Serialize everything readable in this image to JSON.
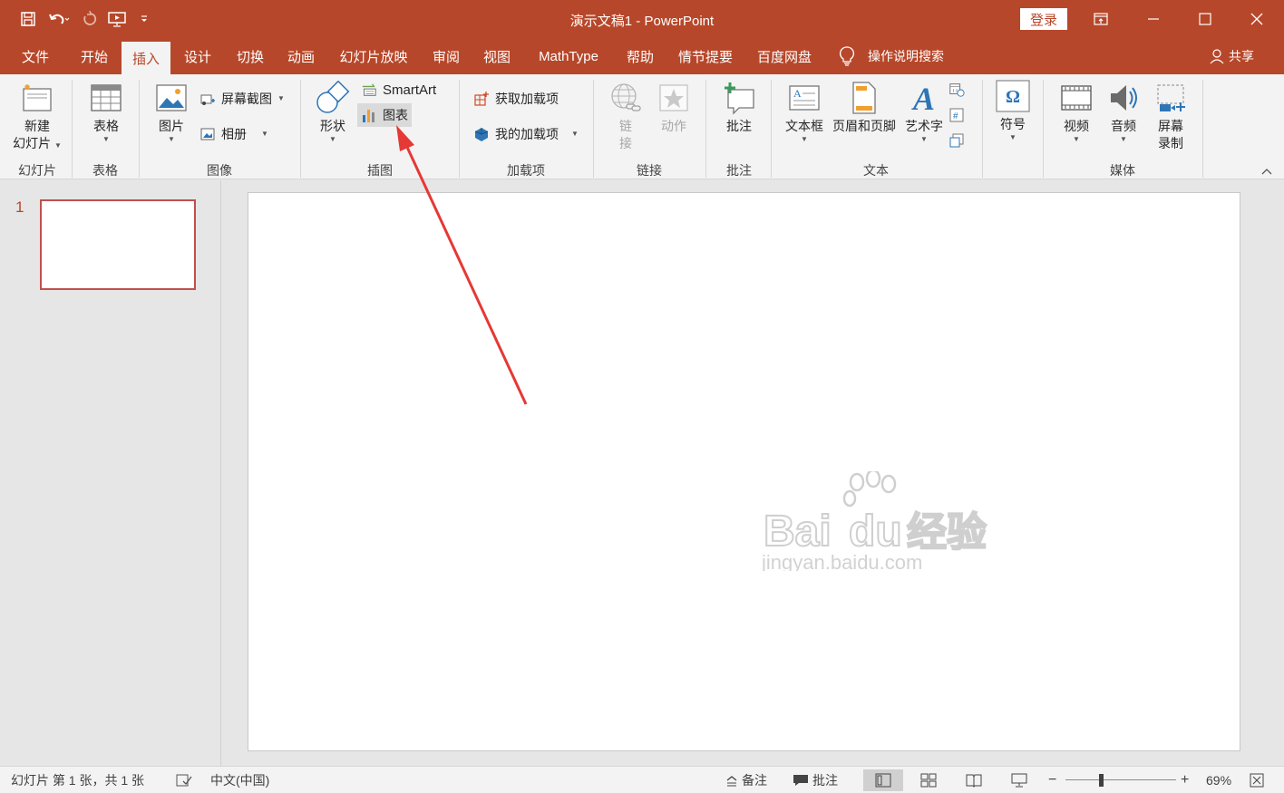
{
  "titlebar": {
    "doc_title": "演示文稿1  -  PowerPoint",
    "login_label": "登录"
  },
  "tabs": [
    "文件",
    "开始",
    "插入",
    "设计",
    "切换",
    "动画",
    "幻灯片放映",
    "审阅",
    "视图",
    "MathType",
    "帮助",
    "情节提要",
    "百度网盘"
  ],
  "active_tab": "插入",
  "tell_me": "操作说明搜索",
  "share": "共享",
  "ribbon": {
    "groups": {
      "slides": "幻灯片",
      "tables": "表格",
      "images": "图像",
      "illustrations": "插图",
      "addins": "加载项",
      "links": "链接",
      "comments": "批注",
      "text": "文本",
      "symbols": "",
      "media": "媒体"
    },
    "new_slide_1": "新建",
    "new_slide_2": "幻灯片",
    "table": "表格",
    "pictures": "图片",
    "screenshot": "屏幕截图",
    "album": "相册",
    "shapes": "形状",
    "smartart": "SmartArt",
    "chart": "图表",
    "get_addins": "获取加载项",
    "my_addins": "我的加载项",
    "link_1": "链",
    "link_2": "接",
    "action": "动作",
    "comment": "批注",
    "textbox": "文本框",
    "header_footer": "页眉和页脚",
    "wordart": "艺术字",
    "symbol": "符号",
    "video": "视频",
    "audio": "音频",
    "screen_rec_1": "屏幕",
    "screen_rec_2": "录制"
  },
  "slides_panel": {
    "slide_number": "1"
  },
  "status": {
    "slide_info": "幻灯片 第 1 张，共 1 张",
    "language": "中文(中国)",
    "notes": "备注",
    "comments": "批注",
    "zoom": "69%"
  },
  "watermark": {
    "line1": "Bai",
    "line2": "du",
    "line3": "经验",
    "url": "jingyan.baidu.com"
  },
  "colors": {
    "brand": "#b7472a",
    "ribbon_bg": "#f3f3f3",
    "annotation_arrow": "#e53935"
  }
}
